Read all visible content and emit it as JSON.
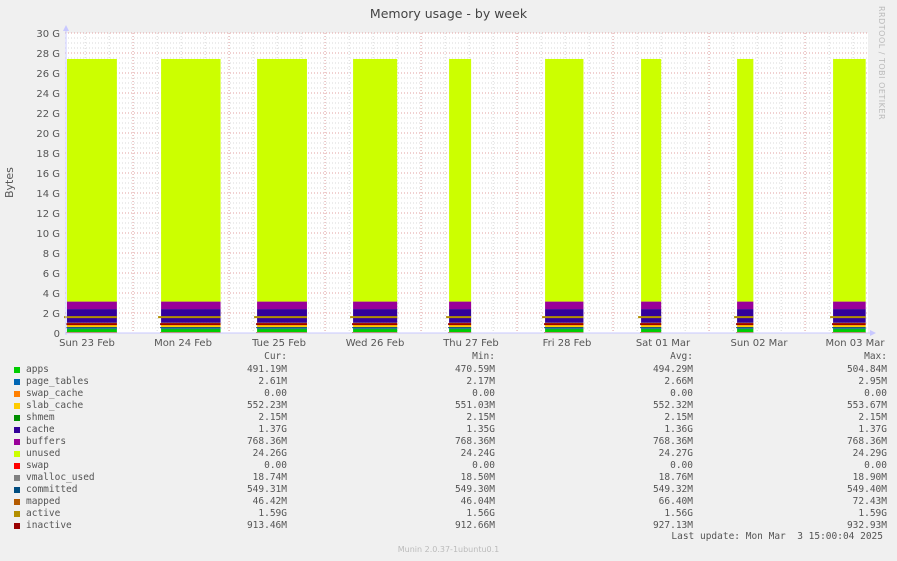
{
  "title": "Memory usage - by week",
  "watermark": "RRDTOOL / TOBI OETIKER",
  "footer": "Munin 2.0.37-1ubuntu0.1",
  "last_update": "Last update: Mon Mar  3 15:00:04 2025",
  "legend_headers": [
    "Cur:",
    "Min:",
    "Avg:",
    "Max:"
  ],
  "legend": [
    {
      "name": "apps",
      "color": "#00cc00",
      "cur": "491.19M",
      "min": "470.59M",
      "avg": "494.29M",
      "max": "504.84M"
    },
    {
      "name": "page_tables",
      "color": "#0066b3",
      "cur": "2.61M",
      "min": "2.17M",
      "avg": "2.66M",
      "max": "2.95M"
    },
    {
      "name": "swap_cache",
      "color": "#ff8000",
      "cur": "0.00",
      "min": "0.00",
      "avg": "0.00",
      "max": "0.00"
    },
    {
      "name": "slab_cache",
      "color": "#ffcc00",
      "cur": "552.23M",
      "min": "551.03M",
      "avg": "552.32M",
      "max": "553.67M"
    },
    {
      "name": "shmem",
      "color": "#008f00",
      "cur": "2.15M",
      "min": "2.15M",
      "avg": "2.15M",
      "max": "2.15M"
    },
    {
      "name": "cache",
      "color": "#330099",
      "cur": "1.37G",
      "min": "1.35G",
      "avg": "1.36G",
      "max": "1.37G"
    },
    {
      "name": "buffers",
      "color": "#990099",
      "cur": "768.36M",
      "min": "768.36M",
      "avg": "768.36M",
      "max": "768.36M"
    },
    {
      "name": "unused",
      "color": "#ccff00",
      "cur": "24.26G",
      "min": "24.24G",
      "avg": "24.27G",
      "max": "24.29G"
    },
    {
      "name": "swap",
      "color": "#ff0000",
      "cur": "0.00",
      "min": "0.00",
      "avg": "0.00",
      "max": "0.00"
    },
    {
      "name": "vmalloc_used",
      "color": "#808080",
      "cur": "18.74M",
      "min": "18.50M",
      "avg": "18.76M",
      "max": "18.90M"
    },
    {
      "name": "committed",
      "color": "#004d80",
      "cur": "549.31M",
      "min": "549.30M",
      "avg": "549.32M",
      "max": "549.40M"
    },
    {
      "name": "mapped",
      "color": "#b35a00",
      "cur": "46.42M",
      "min": "46.04M",
      "avg": "66.40M",
      "max": "72.43M"
    },
    {
      "name": "active",
      "color": "#b38f00",
      "cur": "1.59G",
      "min": "1.56G",
      "avg": "1.56G",
      "max": "1.59G"
    },
    {
      "name": "inactive",
      "color": "#990000",
      "cur": "913.46M",
      "min": "912.66M",
      "avg": "927.13M",
      "max": "932.93M"
    }
  ],
  "chart_data": {
    "type": "area",
    "title": "Memory usage - by week",
    "xlabel": "",
    "ylabel": "Bytes",
    "ylim": [
      0,
      30
    ],
    "y_unit": "G",
    "yticks": [
      "0",
      "2 G",
      "4 G",
      "6 G",
      "8 G",
      "10 G",
      "12 G",
      "14 G",
      "16 G",
      "18 G",
      "20 G",
      "22 G",
      "24 G",
      "26 G",
      "28 G",
      "30 G"
    ],
    "ytick_values": [
      0,
      2,
      4,
      6,
      8,
      10,
      12,
      14,
      16,
      18,
      20,
      22,
      24,
      26,
      28,
      30
    ],
    "x_days": [
      "Sun 23 Feb",
      "Mon 24 Feb",
      "Tue 25 Feb",
      "Wed 26 Feb",
      "Thu 27 Feb",
      "Fri 28 Feb",
      "Sat 01 Mar",
      "Sun 02 Mar",
      "Mon 03 Mar"
    ],
    "x_range_days": [
      0,
      8.37
    ],
    "data_present_intervals_days": [
      [
        0.0,
        0.53
      ],
      [
        0.98,
        1.61
      ],
      [
        1.98,
        2.51
      ],
      [
        2.98,
        3.45
      ],
      [
        3.98,
        4.22
      ],
      [
        4.98,
        5.39
      ],
      [
        5.98,
        6.2
      ],
      [
        6.98,
        7.16
      ],
      [
        7.98,
        8.33
      ]
    ],
    "stack_order": [
      "apps",
      "page_tables",
      "swap_cache",
      "slab_cache",
      "cache",
      "buffers",
      "unused",
      "swap"
    ],
    "stack_values_G": {
      "apps": 0.48,
      "page_tables": 0.0026,
      "swap_cache": 0,
      "slab_cache": 0.54,
      "cache": 1.37,
      "buffers": 0.75,
      "unused": 24.26,
      "swap": 0
    },
    "line_series_G": {
      "shmem": 0.0021,
      "vmalloc_used": 0.018,
      "committed": 0.54,
      "mapped": 0.045,
      "active": 1.59,
      "inactive": 0.89
    },
    "grid": true,
    "legend_position": "bottom"
  }
}
